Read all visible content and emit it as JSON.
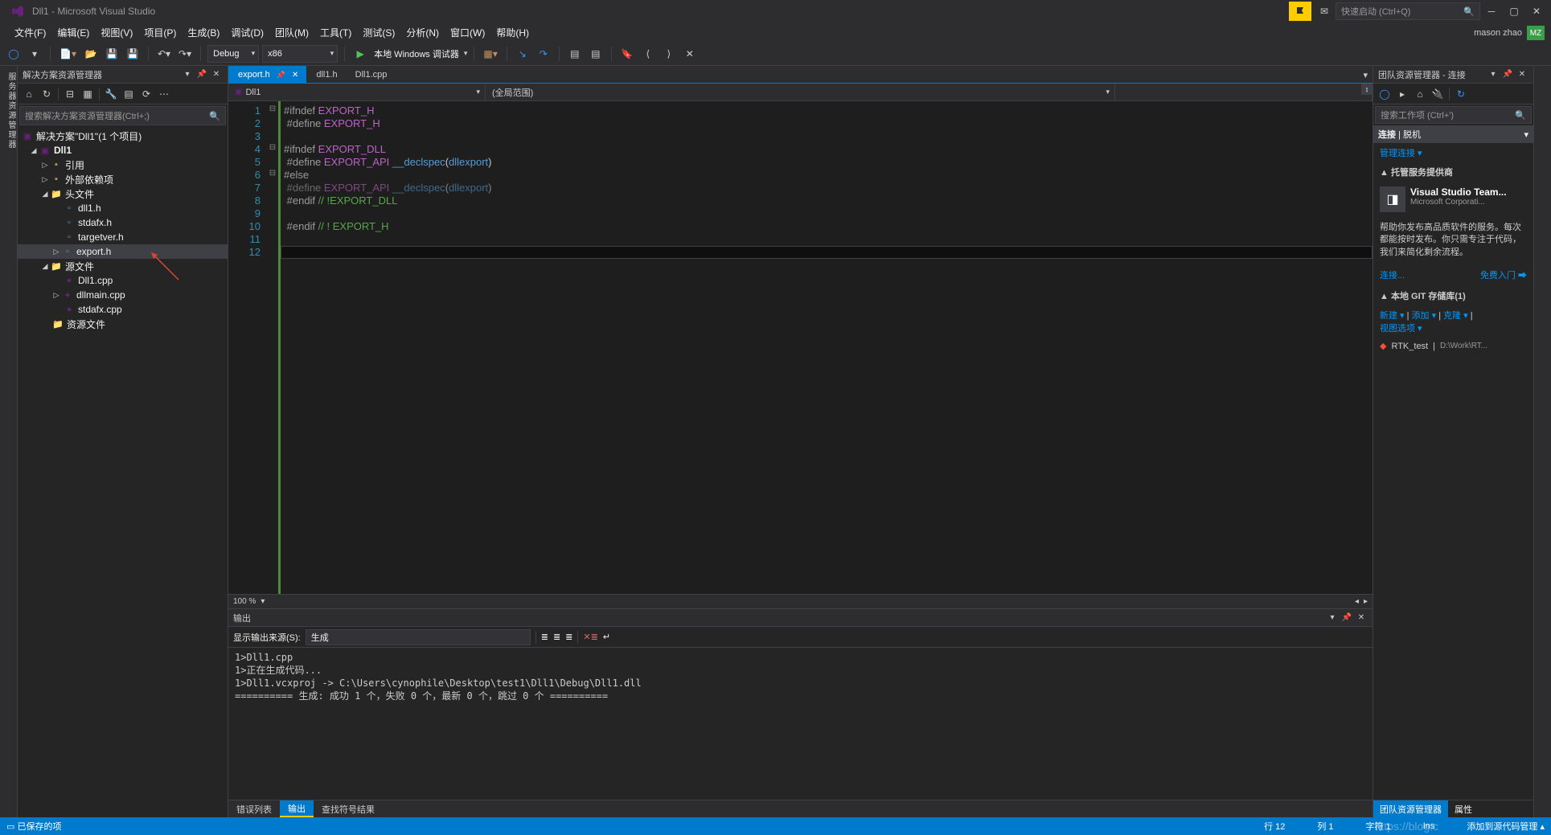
{
  "title": "Dll1 - Microsoft Visual Studio",
  "user": {
    "name": "mason zhao",
    "initials": "MZ"
  },
  "quick_launch_placeholder": "快速启动 (Ctrl+Q)",
  "menu": [
    "文件(F)",
    "编辑(E)",
    "视图(V)",
    "项目(P)",
    "生成(B)",
    "调试(D)",
    "团队(M)",
    "工具(T)",
    "测试(S)",
    "分析(N)",
    "窗口(W)",
    "帮助(H)"
  ],
  "toolbar": {
    "config": "Debug",
    "platform": "x86",
    "debugger": "本地 Windows 调试器"
  },
  "solution_panel": {
    "title": "解决方案资源管理器",
    "search_placeholder": "搜索解决方案资源管理器(Ctrl+;)",
    "tree": {
      "solution": "解决方案\"Dll1\"(1 个项目)",
      "project": "Dll1",
      "refs": "引用",
      "external": "外部依赖项",
      "headers": "头文件",
      "header_files": [
        "dll1.h",
        "stdafx.h",
        "targetver.h",
        "export.h"
      ],
      "sources": "源文件",
      "source_files": [
        "Dll1.cpp",
        "dllmain.cpp",
        "stdafx.cpp"
      ],
      "resources": "资源文件"
    }
  },
  "editor": {
    "tabs": [
      {
        "label": "export.h",
        "active": true,
        "pinned": true
      },
      {
        "label": "dll1.h",
        "active": false
      },
      {
        "label": "Dll1.cpp",
        "active": false
      }
    ],
    "nav_left": "Dll1",
    "nav_right": "(全局范围)",
    "zoom": "100 %",
    "lines": [
      {
        "n": 1,
        "html": "<span class='c-pp'>#ifndef </span><span class='c-mac'>EXPORT_H</span>"
      },
      {
        "n": 2,
        "html": " <span class='c-pp'>#define </span><span class='c-mac'>EXPORT_H</span>"
      },
      {
        "n": 3,
        "html": ""
      },
      {
        "n": 4,
        "html": "<span class='c-pp'>#ifndef </span><span class='c-mac'>EXPORT_DLL</span>"
      },
      {
        "n": 5,
        "html": " <span class='c-pp'>#define </span><span class='c-mac'>EXPORT_API </span><span class='c-kw'>__declspec</span><span class='c-paren'>(</span><span class='c-kw'>dllexport</span><span class='c-paren'>)</span>"
      },
      {
        "n": 6,
        "html": "<span class='c-pp'>#else</span>"
      },
      {
        "n": 7,
        "html": " <span class='c-pp' style='opacity:.6'>#define </span><span class='c-mac' style='opacity:.6'>EXPORT_API </span><span class='c-kw' style='opacity:.6'>__declspec</span><span class='c-paren' style='opacity:.6'>(</span><span class='c-kw' style='opacity:.6'>dllexport</span><span class='c-paren' style='opacity:.6'>)</span>"
      },
      {
        "n": 8,
        "html": " <span class='c-pp'>#endif </span><span class='c-com'>// !EXPORT_DLL</span>"
      },
      {
        "n": 9,
        "html": ""
      },
      {
        "n": 10,
        "html": " <span class='c-pp'>#endif </span><span class='c-com'>// ! EXPORT_H</span>"
      },
      {
        "n": 11,
        "html": ""
      },
      {
        "n": 12,
        "html": ""
      }
    ]
  },
  "output": {
    "title": "输出",
    "source_label": "显示输出来源(S):",
    "source_value": "生成",
    "lines": [
      "1>Dll1.cpp",
      "1>正在生成代码...",
      "1>Dll1.vcxproj -> C:\\Users\\cynophile\\Desktop\\test1\\Dll1\\Debug\\Dll1.dll",
      "========== 生成: 成功 1 个，失败 0 个，最新 0 个，跳过 0 个 =========="
    ],
    "tabs": [
      "错误列表",
      "输出",
      "查找符号结果"
    ]
  },
  "team": {
    "title": "团队资源管理器 - 连接",
    "search_placeholder": "搜索工作项 (Ctrl+')",
    "section_conn": "连接",
    "section_offline": "脱机",
    "manage_conn": "管理连接",
    "hosted_header": "托管服务提供商",
    "vsts_name": "Visual Studio Team...",
    "vsts_org": "Microsoft Corporati...",
    "vsts_desc": "帮助你发布高品质软件的服务。每次都能按时发布。你只需专注于代码，我们来简化剩余流程。",
    "connect_link": "连接...",
    "free_link": "免费入门",
    "localgit_header": "本地 GIT 存储库(1)",
    "git_new": "新建",
    "git_add": "添加",
    "git_clone": "克隆",
    "git_view": "视图选项",
    "repo_name": "RTK_test",
    "repo_path": "D:\\Work\\RT...",
    "footer_tabs": [
      "团队资源管理器",
      "属性"
    ]
  },
  "status": {
    "saved": "已保存的项",
    "line": "行 12",
    "col": "列 1",
    "char": "字符 1",
    "ins": "Ins",
    "src_ctrl": "添加到源代码管理"
  },
  "left_rail_label": "服务器资源管理器"
}
